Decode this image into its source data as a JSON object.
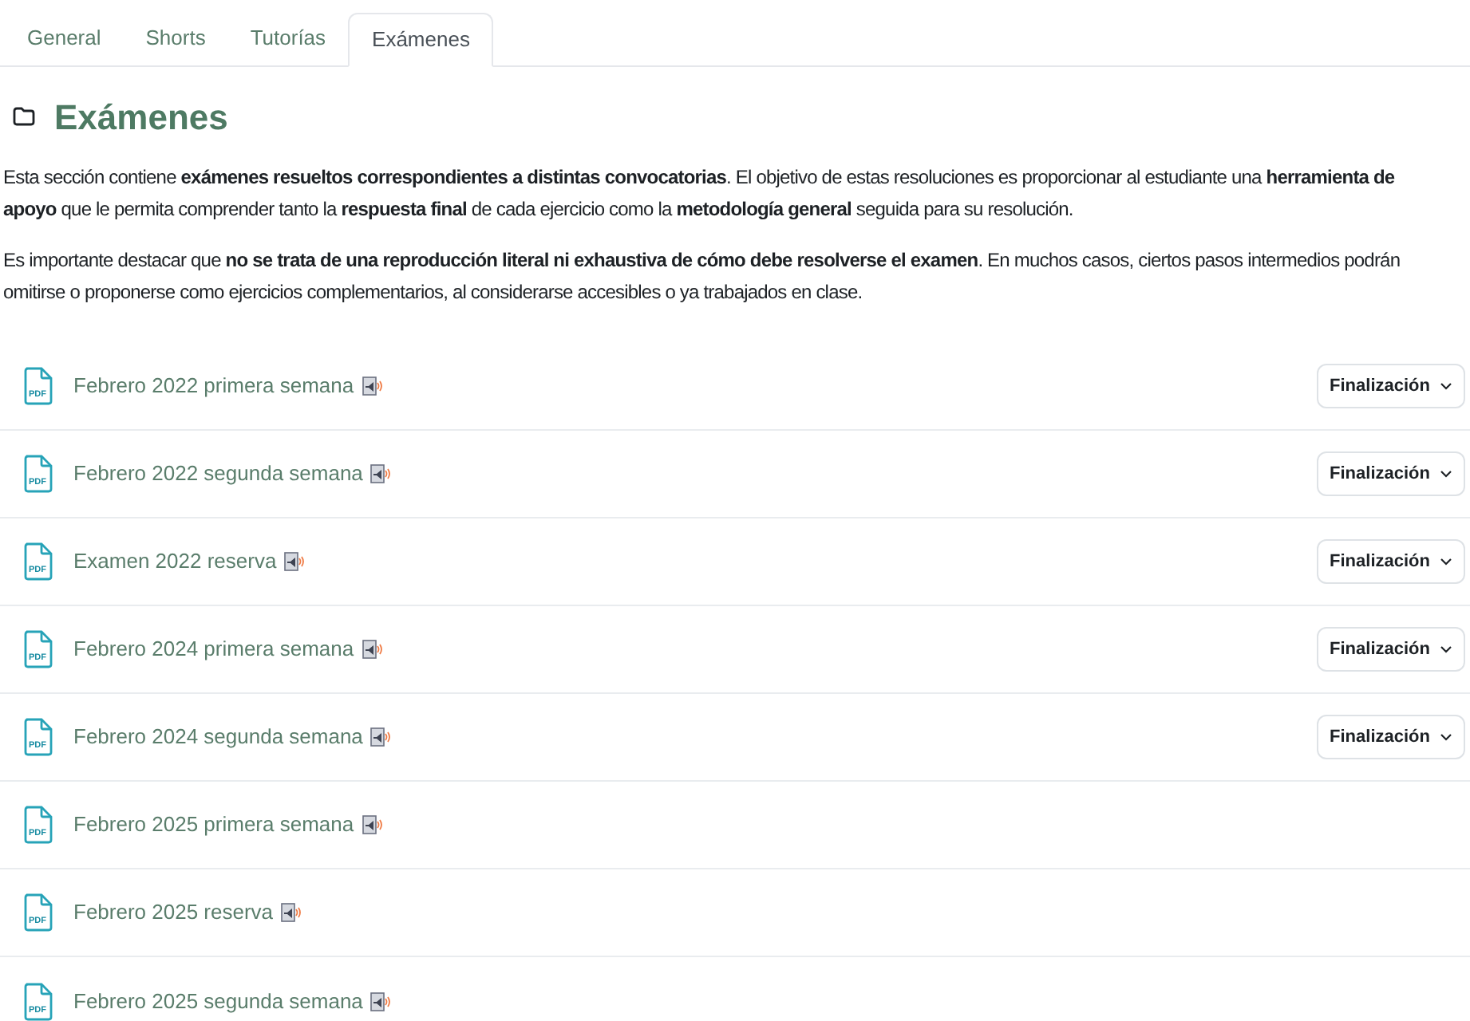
{
  "tabs": [
    {
      "label": "General",
      "selected": false
    },
    {
      "label": "Shorts",
      "selected": false
    },
    {
      "label": "Tutorías",
      "selected": false
    },
    {
      "label": "Exámenes",
      "selected": true
    }
  ],
  "section": {
    "title": "Exámenes",
    "paragraphs": [
      [
        "Esta sección contiene **exámenes resueltos correspondientes a distintas convocatorias**. El objetivo de estas resoluciones es proporcionar al estudiante una **herramienta de**",
        "**apoyo** que le permita comprender tanto la **respuesta final** de cada ejercicio como la **metodología general** seguida para su resolución."
      ],
      [
        "Es importante destacar que **no se trata de una reproducción literal ni exhaustiva de cómo debe resolverse el examen**. En muchos casos, ciertos pasos intermedios podrán",
        "omitirse o proponerse como ejercicios complementarios, al considerarse accesibles o ya trabajados en clase."
      ]
    ]
  },
  "activities": [
    {
      "icon_label": "PDF",
      "name": "Febrero 2022 primera semana",
      "completion": "Finalización"
    },
    {
      "icon_label": "PDF",
      "name": "Febrero 2022 segunda semana",
      "completion": "Finalización"
    },
    {
      "icon_label": "PDF",
      "name": "Examen 2022 reserva",
      "completion": "Finalización"
    },
    {
      "icon_label": "PDF",
      "name": "Febrero 2024 primera semana",
      "completion": "Finalización"
    },
    {
      "icon_label": "PDF",
      "name": "Febrero 2024 segunda semana",
      "completion": "Finalización"
    },
    {
      "icon_label": "PDF",
      "name": "Febrero 2025 primera semana"
    },
    {
      "icon_label": "PDF",
      "name": "Febrero 2025 reserva"
    },
    {
      "icon_label": "PDF",
      "name": "Febrero 2025 segunda semana"
    }
  ]
}
